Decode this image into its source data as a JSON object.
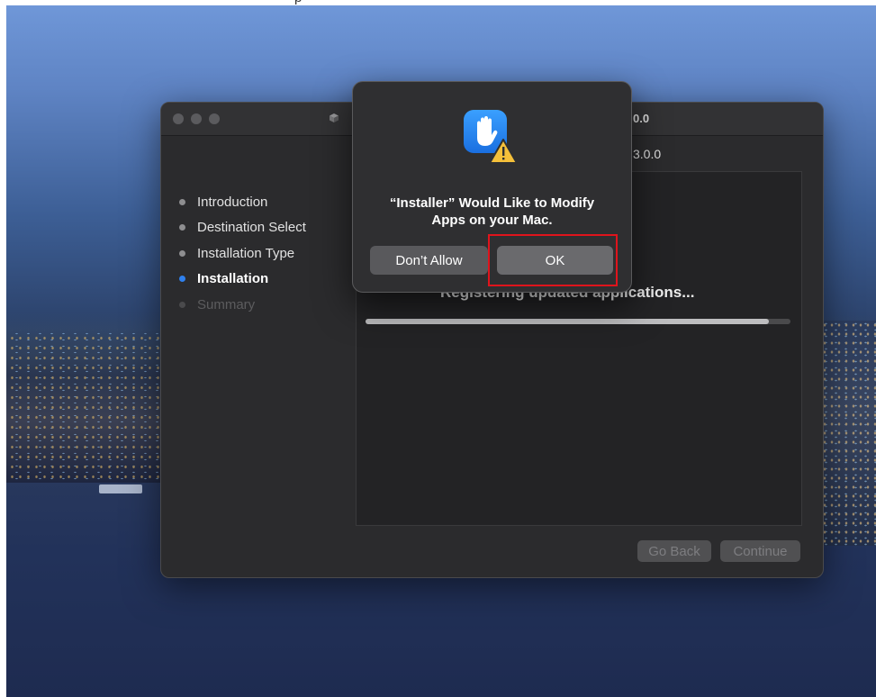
{
  "caption": {
    "text": "p"
  },
  "desktop": {
    "wallpaper": "harbour city night skyline",
    "colors": {
      "sky_top": "#6f97d8",
      "water": "#22325a"
    }
  },
  "installer_window": {
    "title_fragment": "0.0",
    "subtitle_fragment": "3.0.0",
    "steps": [
      {
        "label": "Introduction",
        "state": "done"
      },
      {
        "label": "Destination Select",
        "state": "done"
      },
      {
        "label": "Installation Type",
        "state": "done"
      },
      {
        "label": "Installation",
        "state": "current"
      },
      {
        "label": "Summary",
        "state": "pending"
      }
    ],
    "status_text": "Registering updated applications...",
    "progress_fraction": 0.95,
    "buttons": {
      "go_back": "Go Back",
      "continue": "Continue"
    },
    "colors": {
      "window_bg": "#2b2b2d",
      "active_step_dot": "#2f80ed"
    }
  },
  "permission_dialog": {
    "icon": "hand-stop-warning-icon",
    "message_line1": "“Installer” Would Like to Modify",
    "message_line2": "Apps on your Mac.",
    "buttons": {
      "deny": "Don’t Allow",
      "allow": "OK"
    },
    "highlight_color": "#e0141c"
  }
}
